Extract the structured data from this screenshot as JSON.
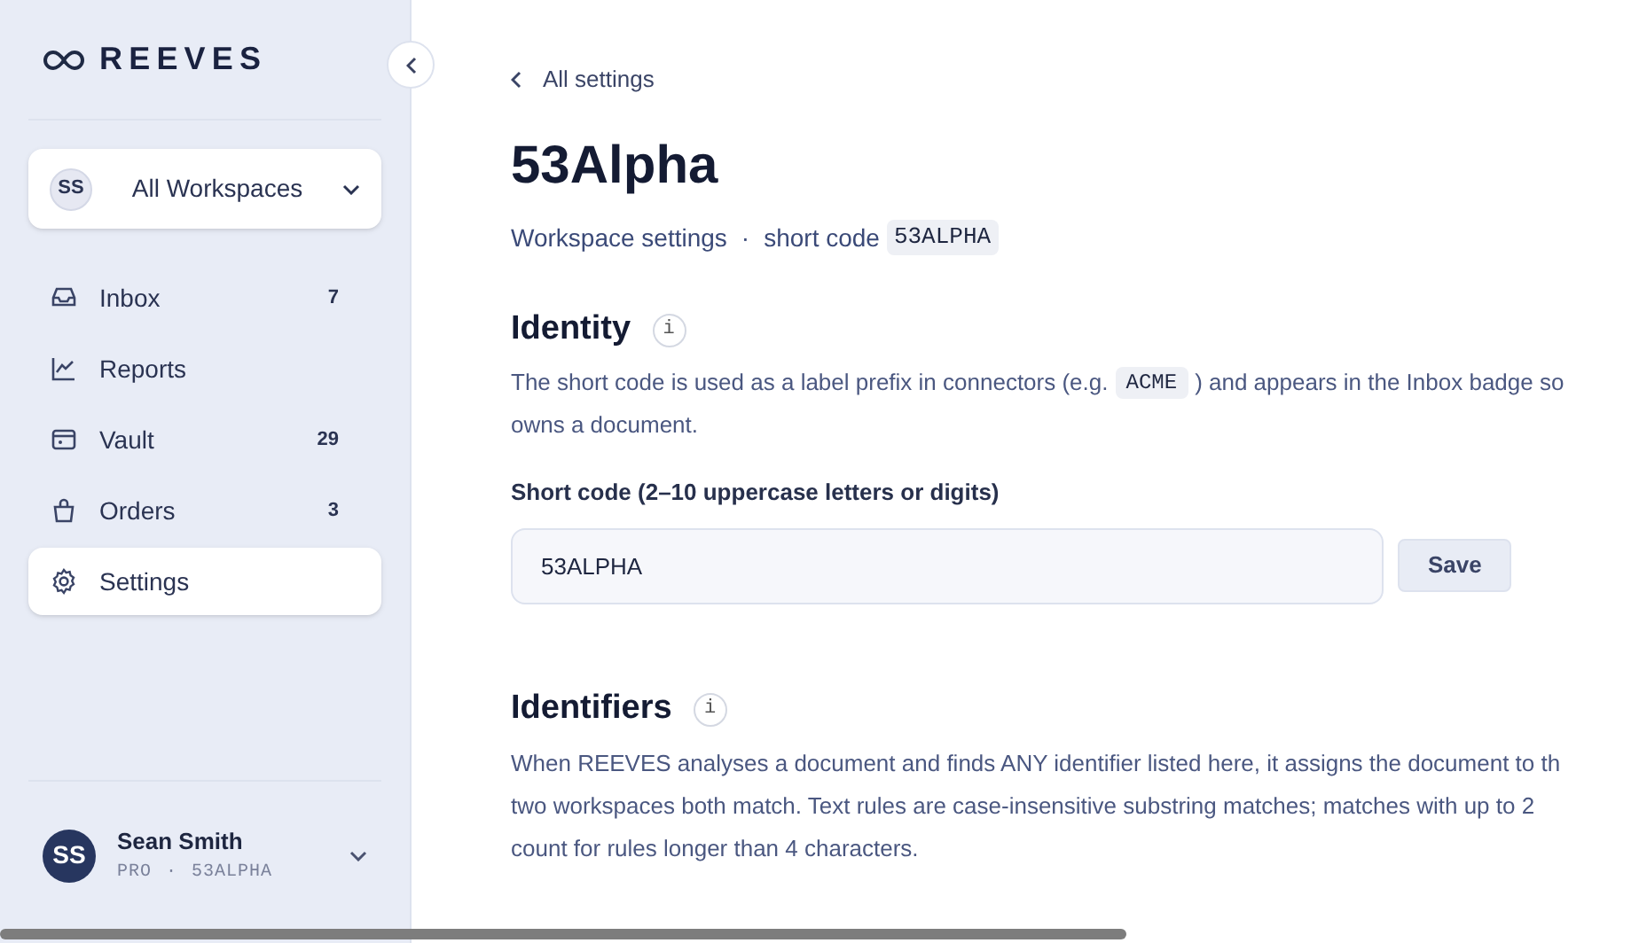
{
  "sidebar": {
    "logo": "REEVES",
    "workspace": {
      "initials": "SS",
      "label": "All Workspaces"
    },
    "items": [
      {
        "label": "Inbox",
        "kind": "inbox",
        "count": "7",
        "selected": false
      },
      {
        "label": "Reports",
        "kind": "reports",
        "selected": false
      },
      {
        "label": "Vault",
        "kind": "vault",
        "count": "29",
        "selected": false
      },
      {
        "label": "Orders",
        "kind": "orders",
        "count": "3",
        "selected": false
      },
      {
        "label": "Settings",
        "kind": "settings",
        "selected": true
      }
    ],
    "user": {
      "initials": "SS",
      "name": "Sean Smith",
      "plan": "PRO",
      "separator": "·",
      "code": "53ALPHA"
    }
  },
  "back_link": "All settings",
  "title": "53Alpha",
  "subtitle": {
    "text": "Workspace settings",
    "separator": "·",
    "label": "short code",
    "code": "53ALPHA"
  },
  "identity": {
    "heading": "Identity",
    "info": "i",
    "line_1_before": "The short code is used as a label prefix in connectors (e.g.",
    "line_1_code": "ACME",
    "line_1_after": ") and appears in the Inbox badge so",
    "line_2": "owns a document.",
    "field_label": "Short code (2–10 uppercase letters or digits)",
    "field_value": "53ALPHA",
    "save": "Save"
  },
  "identifiers": {
    "heading": "Identifiers",
    "info": "i",
    "lines": [
      "When REEVES analyses a document and finds ANY identifier listed here, it assigns the document to th",
      "two workspaces both match. Text rules are case-insensitive substring matches; matches with up to 2",
      "count for rules longer than 4 characters."
    ]
  }
}
